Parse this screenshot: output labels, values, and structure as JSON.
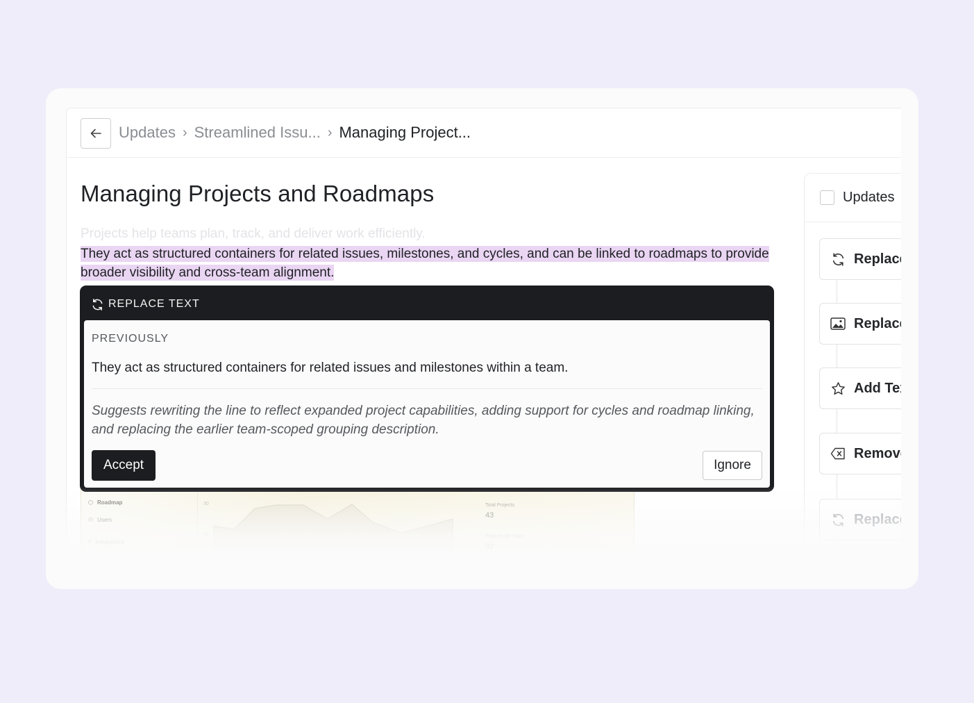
{
  "breadcrumb": {
    "items": [
      "Updates",
      "Streamlined Issu...",
      "Managing Project..."
    ]
  },
  "page": {
    "title": "Managing Projects and Roadmaps",
    "ghost_line": "Projects help teams plan, track, and deliver work efficiently.",
    "highlighted_text": "They act as structured containers for related issues, milestones, and cycles, and can be linked to roadmaps to provide broader visibility and cross-team alignment."
  },
  "popup": {
    "header": "REPLACE TEXT",
    "previously_label": "PREVIOUSLY",
    "previous_text": "They act as structured containers for related issues and milestones within a team.",
    "suggestion": "Suggests rewriting the line to reflect expanded project capabilities, adding support for cycles and roadmap linking, and replacing the earlier team-scoped grouping description.",
    "accept_label": "Accept",
    "ignore_label": "Ignore"
  },
  "thumbnail": {
    "nav": [
      "Roadmap",
      "Users",
      "Integrations"
    ],
    "axis": [
      "30",
      "20"
    ],
    "stats": [
      {
        "label": "Total Projects",
        "value": "43"
      },
      {
        "label": "Projects On Track",
        "value": "32"
      }
    ]
  },
  "sidebar": {
    "header": "Updates",
    "items": [
      {
        "label": "Replace",
        "icon": "refresh-icon"
      },
      {
        "label": "Replace",
        "icon": "image-icon"
      },
      {
        "label": "Add Tex",
        "icon": "star-icon"
      },
      {
        "label": "Remove",
        "icon": "backspace-icon"
      },
      {
        "label": "Replace",
        "icon": "refresh-icon"
      }
    ]
  },
  "colors": {
    "background": "#efedfa",
    "highlight": "#ead5f3",
    "popup_dark": "#1c1d20"
  }
}
